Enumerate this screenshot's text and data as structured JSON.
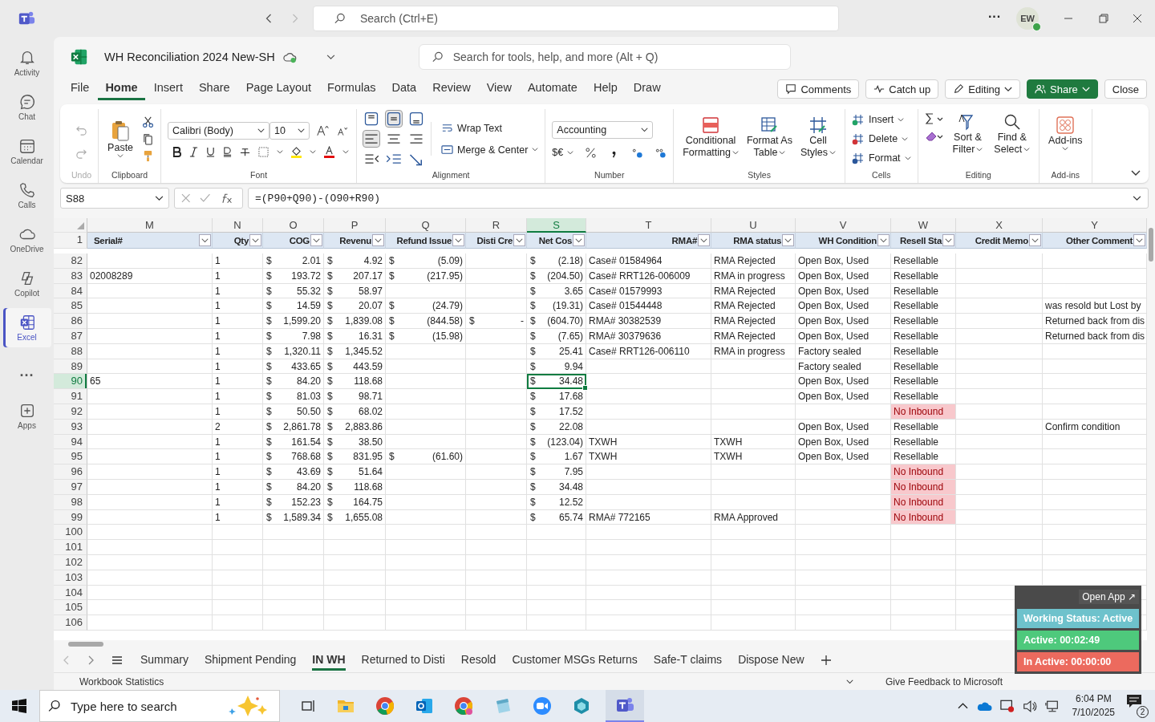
{
  "teams": {
    "search_placeholder": "Search (Ctrl+E)",
    "more": "···",
    "avatar": "EW",
    "rail": [
      {
        "label": "Activity",
        "kind": "bell",
        "selected": false
      },
      {
        "label": "Chat",
        "kind": "chat",
        "selected": false
      },
      {
        "label": "Calendar",
        "kind": "calendar",
        "selected": false
      },
      {
        "label": "Calls",
        "kind": "phone",
        "selected": false
      },
      {
        "label": "OneDrive",
        "kind": "cloud",
        "selected": false
      },
      {
        "label": "Copilot",
        "kind": "copilot",
        "selected": false
      },
      {
        "label": "Excel",
        "kind": "excel",
        "selected": true
      },
      {
        "label": "...",
        "kind": "more",
        "selected": false
      },
      {
        "label": "Apps",
        "kind": "apps",
        "selected": false
      }
    ]
  },
  "excel": {
    "title": "WH Reconciliation 2024 New-SH",
    "search_placeholder": "Search for tools, help, and more (Alt + Q)",
    "menu_tabs": [
      {
        "label": "File",
        "selected": false
      },
      {
        "label": "Home",
        "selected": true
      },
      {
        "label": "Insert",
        "selected": false
      },
      {
        "label": "Share",
        "selected": false
      },
      {
        "label": "Page Layout",
        "selected": false
      },
      {
        "label": "Formulas",
        "selected": false
      },
      {
        "label": "Data",
        "selected": false
      },
      {
        "label": "Review",
        "selected": false
      },
      {
        "label": "View",
        "selected": false
      },
      {
        "label": "Automate",
        "selected": false
      },
      {
        "label": "Help",
        "selected": false
      },
      {
        "label": "Draw",
        "selected": false
      }
    ],
    "actions": [
      {
        "label": "Comments",
        "kind": "comments"
      },
      {
        "label": "Catch up",
        "kind": "catchup"
      },
      {
        "label": "Editing",
        "kind": "editing"
      },
      {
        "label": "Share",
        "kind": "share"
      },
      {
        "label": "Close",
        "kind": "close"
      }
    ],
    "ribbon": {
      "undo_label": "Undo",
      "paste": "Paste",
      "clipboard_label": "Clipboard",
      "font_name": "Calibri (Body)",
      "font_size": "10",
      "font_label": "Font",
      "wrap_text": "Wrap Text",
      "merge_center": "Merge & Center",
      "alignment_label": "Alignment",
      "number_format": "Accounting",
      "currency": "$€",
      "number_label": "Number",
      "styles": [
        [
          "Conditional",
          "Formatting"
        ],
        [
          "Format As",
          "Table"
        ],
        [
          "Cell",
          "Styles"
        ]
      ],
      "styles_label": "Styles",
      "cells": [
        "Insert",
        "Delete",
        "Format"
      ],
      "cells_label": "Cells",
      "editing": [
        [
          "Sort &",
          "Filter"
        ],
        [
          "Find &",
          "Select"
        ]
      ],
      "editing_label": "Editing",
      "addins": "Add-ins",
      "addins_label": "Add-ins"
    },
    "name_box": "S88",
    "formula": "=(P90+Q90)-(O90+R90)"
  },
  "grid": {
    "columns": [
      {
        "letter": "M",
        "header": "Serial#",
        "kind": "text",
        "selected": false
      },
      {
        "letter": "N",
        "header": "Qty",
        "kind": "text",
        "selected": false
      },
      {
        "letter": "O",
        "header": "COG",
        "kind": "money",
        "selected": false
      },
      {
        "letter": "P",
        "header": "Revenu",
        "kind": "money",
        "selected": false
      },
      {
        "letter": "Q",
        "header": "Refund Issue",
        "kind": "money",
        "selected": false
      },
      {
        "letter": "R",
        "header": "Disti Cre",
        "kind": "money",
        "selected": false
      },
      {
        "letter": "S",
        "header": "Net Cos",
        "kind": "money",
        "selected": true
      },
      {
        "letter": "T",
        "header": "RMA#",
        "kind": "text",
        "selected": false
      },
      {
        "letter": "U",
        "header": "RMA status",
        "kind": "text",
        "selected": false
      },
      {
        "letter": "V",
        "header": "WH Condition",
        "kind": "text",
        "selected": false
      },
      {
        "letter": "W",
        "header": "Resell Sta",
        "kind": "status",
        "selected": false
      },
      {
        "letter": "X",
        "header": "Credit Memo",
        "kind": "text",
        "selected": false
      },
      {
        "letter": "Y",
        "header": "Other Comment",
        "kind": "text",
        "selected": false
      }
    ],
    "header_row": "1",
    "rows": [
      {
        "num": "82",
        "selected": false,
        "cells": {
          "N": "1",
          "O": {
            "cur": "$",
            "amt": "2.01"
          },
          "P": {
            "cur": "$",
            "amt": "4.92"
          },
          "Q": {
            "cur": "$",
            "amt": "(5.09)"
          },
          "S": {
            "cur": "$",
            "amt": "(2.18)"
          },
          "T": "Case# 01584964",
          "U": "RMA Rejected",
          "V": "Open Box, Used",
          "W": {
            "text": "Resellable",
            "alert": false
          }
        }
      },
      {
        "num": "83",
        "selected": false,
        "cells": {
          "M": "02008289",
          "N": "1",
          "O": {
            "cur": "$",
            "amt": "193.72"
          },
          "P": {
            "cur": "$",
            "amt": "207.17"
          },
          "Q": {
            "cur": "$",
            "amt": "(217.95)"
          },
          "S": {
            "cur": "$",
            "amt": "(204.50)"
          },
          "T": "Case# RRT126-006009",
          "U": "RMA in progress",
          "V": "Open Box, Used",
          "W": {
            "text": "Resellable",
            "alert": false
          }
        }
      },
      {
        "num": "84",
        "selected": false,
        "cells": {
          "N": "1",
          "O": {
            "cur": "$",
            "amt": "55.32"
          },
          "P": {
            "cur": "$",
            "amt": "58.97"
          },
          "S": {
            "cur": "$",
            "amt": "3.65"
          },
          "T": "Case# 01579993",
          "U": "RMA Rejected",
          "V": "Open Box, Used",
          "W": {
            "text": "Resellable",
            "alert": false
          }
        }
      },
      {
        "num": "85",
        "selected": false,
        "cells": {
          "N": "1",
          "O": {
            "cur": "$",
            "amt": "14.59"
          },
          "P": {
            "cur": "$",
            "amt": "20.07"
          },
          "Q": {
            "cur": "$",
            "amt": "(24.79)"
          },
          "S": {
            "cur": "$",
            "amt": "(19.31)"
          },
          "T": "Case# 01544448",
          "U": "RMA Rejected",
          "V": "Open Box, Used",
          "W": {
            "text": "Resellable",
            "alert": false
          },
          "Y": "was resold but Lost by"
        }
      },
      {
        "num": "86",
        "selected": false,
        "cells": {
          "N": "1",
          "O": {
            "cur": "$",
            "amt": "1,599.20"
          },
          "P": {
            "cur": "$",
            "amt": "1,839.08"
          },
          "Q": {
            "cur": "$",
            "amt": "(844.58)"
          },
          "R": {
            "cur": "$",
            "amt": "-"
          },
          "S": {
            "cur": "$",
            "amt": "(604.70)"
          },
          "T": "RMA# 30382539",
          "U": "RMA Rejected",
          "V": "Open Box, Used",
          "W": {
            "text": "Resellable",
            "alert": false
          },
          "Y": "Returned back from dis"
        }
      },
      {
        "num": "87",
        "selected": false,
        "cells": {
          "N": "1",
          "O": {
            "cur": "$",
            "amt": "7.98"
          },
          "P": {
            "cur": "$",
            "amt": "16.31"
          },
          "Q": {
            "cur": "$",
            "amt": "(15.98)"
          },
          "S": {
            "cur": "$",
            "amt": "(7.65)"
          },
          "T": "RMA# 30379636",
          "U": "RMA Rejected",
          "V": "Open Box, Used",
          "W": {
            "text": "Resellable",
            "alert": false
          },
          "Y": "Returned back from dis"
        }
      },
      {
        "num": "88",
        "selected": false,
        "cells": {
          "N": "1",
          "O": {
            "cur": "$",
            "amt": "1,320.11"
          },
          "P": {
            "cur": "$",
            "amt": "1,345.52"
          },
          "S": {
            "cur": "$",
            "amt": "25.41"
          },
          "T": "Case# RRT126-006110",
          "U": "RMA in progress",
          "V": "Factory sealed",
          "W": {
            "text": "Resellable",
            "alert": false
          }
        }
      },
      {
        "num": "89",
        "selected": false,
        "cells": {
          "N": "1",
          "O": {
            "cur": "$",
            "amt": "433.65"
          },
          "P": {
            "cur": "$",
            "amt": "443.59"
          },
          "S": {
            "cur": "$",
            "amt": "9.94"
          },
          "V": "Factory sealed",
          "W": {
            "text": "Resellable",
            "alert": false
          }
        }
      },
      {
        "num": "90",
        "selected": true,
        "cells": {
          "M": "65",
          "N": "1",
          "O": {
            "cur": "$",
            "amt": "84.20"
          },
          "P": {
            "cur": "$",
            "amt": "118.68"
          },
          "S": {
            "cur": "$",
            "amt": "34.48"
          },
          "V": "Open Box, Used",
          "W": {
            "text": "Resellable",
            "alert": false
          }
        }
      },
      {
        "num": "91",
        "selected": false,
        "cells": {
          "N": "1",
          "O": {
            "cur": "$",
            "amt": "81.03"
          },
          "P": {
            "cur": "$",
            "amt": "98.71"
          },
          "S": {
            "cur": "$",
            "amt": "17.68"
          },
          "V": "Open Box, Used",
          "W": {
            "text": "Resellable",
            "alert": false
          }
        }
      },
      {
        "num": "92",
        "selected": false,
        "cells": {
          "N": "1",
          "O": {
            "cur": "$",
            "amt": "50.50"
          },
          "P": {
            "cur": "$",
            "amt": "68.02"
          },
          "S": {
            "cur": "$",
            "amt": "17.52"
          },
          "W": {
            "text": "No Inbound",
            "alert": true
          }
        }
      },
      {
        "num": "93",
        "selected": false,
        "cells": {
          "N": "2",
          "O": {
            "cur": "$",
            "amt": "2,861.78"
          },
          "P": {
            "cur": "$",
            "amt": "2,883.86"
          },
          "S": {
            "cur": "$",
            "amt": "22.08"
          },
          "V": "Open Box, Used",
          "W": {
            "text": "Resellable",
            "alert": false
          },
          "Y": "Confirm condition"
        }
      },
      {
        "num": "94",
        "selected": false,
        "cells": {
          "N": "1",
          "O": {
            "cur": "$",
            "amt": "161.54"
          },
          "P": {
            "cur": "$",
            "amt": "38.50"
          },
          "S": {
            "cur": "$",
            "amt": "(123.04)"
          },
          "T": "TXWH",
          "U": "TXWH",
          "V": "Open Box, Used",
          "W": {
            "text": "Resellable",
            "alert": false
          }
        }
      },
      {
        "num": "95",
        "selected": false,
        "cells": {
          "N": "1",
          "O": {
            "cur": "$",
            "amt": "768.68"
          },
          "P": {
            "cur": "$",
            "amt": "831.95"
          },
          "Q": {
            "cur": "$",
            "amt": "(61.60)"
          },
          "S": {
            "cur": "$",
            "amt": "1.67"
          },
          "T": "TXWH",
          "U": "TXWH",
          "V": "Open Box, Used",
          "W": {
            "text": "Resellable",
            "alert": false
          }
        }
      },
      {
        "num": "96",
        "selected": false,
        "cells": {
          "N": "1",
          "O": {
            "cur": "$",
            "amt": "43.69"
          },
          "P": {
            "cur": "$",
            "amt": "51.64"
          },
          "S": {
            "cur": "$",
            "amt": "7.95"
          },
          "W": {
            "text": "No Inbound",
            "alert": true
          }
        }
      },
      {
        "num": "97",
        "selected": false,
        "cells": {
          "N": "1",
          "O": {
            "cur": "$",
            "amt": "84.20"
          },
          "P": {
            "cur": "$",
            "amt": "118.68"
          },
          "S": {
            "cur": "$",
            "amt": "34.48"
          },
          "W": {
            "text": "No Inbound",
            "alert": true
          }
        }
      },
      {
        "num": "98",
        "selected": false,
        "cells": {
          "N": "1",
          "O": {
            "cur": "$",
            "amt": "152.23"
          },
          "P": {
            "cur": "$",
            "amt": "164.75"
          },
          "S": {
            "cur": "$",
            "amt": "12.52"
          },
          "W": {
            "text": "No Inbound",
            "alert": true
          }
        }
      },
      {
        "num": "99",
        "selected": false,
        "cells": {
          "N": "1",
          "O": {
            "cur": "$",
            "amt": "1,589.34"
          },
          "P": {
            "cur": "$",
            "amt": "1,655.08"
          },
          "S": {
            "cur": "$",
            "amt": "65.74"
          },
          "T": "RMA# 772165",
          "U": "RMA Approved",
          "W": {
            "text": "No Inbound",
            "alert": true
          }
        }
      }
    ],
    "empty_rows": [
      "100",
      "101",
      "102",
      "103",
      "104",
      "105",
      "106"
    ]
  },
  "sheets": [
    {
      "label": "Summary",
      "selected": false
    },
    {
      "label": "Shipment Pending",
      "selected": false
    },
    {
      "label": "IN WH",
      "selected": true
    },
    {
      "label": "Returned to Disti",
      "selected": false
    },
    {
      "label": "Resold",
      "selected": false
    },
    {
      "label": "Customer MSGs Returns",
      "selected": false
    },
    {
      "label": "Safe-T claims",
      "selected": false
    },
    {
      "label": "Dispose New",
      "selected": false
    }
  ],
  "status_bar": {
    "left": "Workbook Statistics",
    "feedback": "Give Feedback to Microsoft"
  },
  "widget": {
    "open_app": "Open App ↗",
    "items": [
      {
        "text": "Working Status: Active",
        "color": "#6ec2cc"
      },
      {
        "text": "Active: 00:02:49",
        "color": "#4ec97c"
      },
      {
        "text": "In Active: 00:00:00",
        "color": "#ec6a5e"
      }
    ]
  },
  "taskbar": {
    "search_placeholder": "Type here to search",
    "time": "6:04 PM",
    "date": "7/10/2025",
    "notifications": "2"
  }
}
